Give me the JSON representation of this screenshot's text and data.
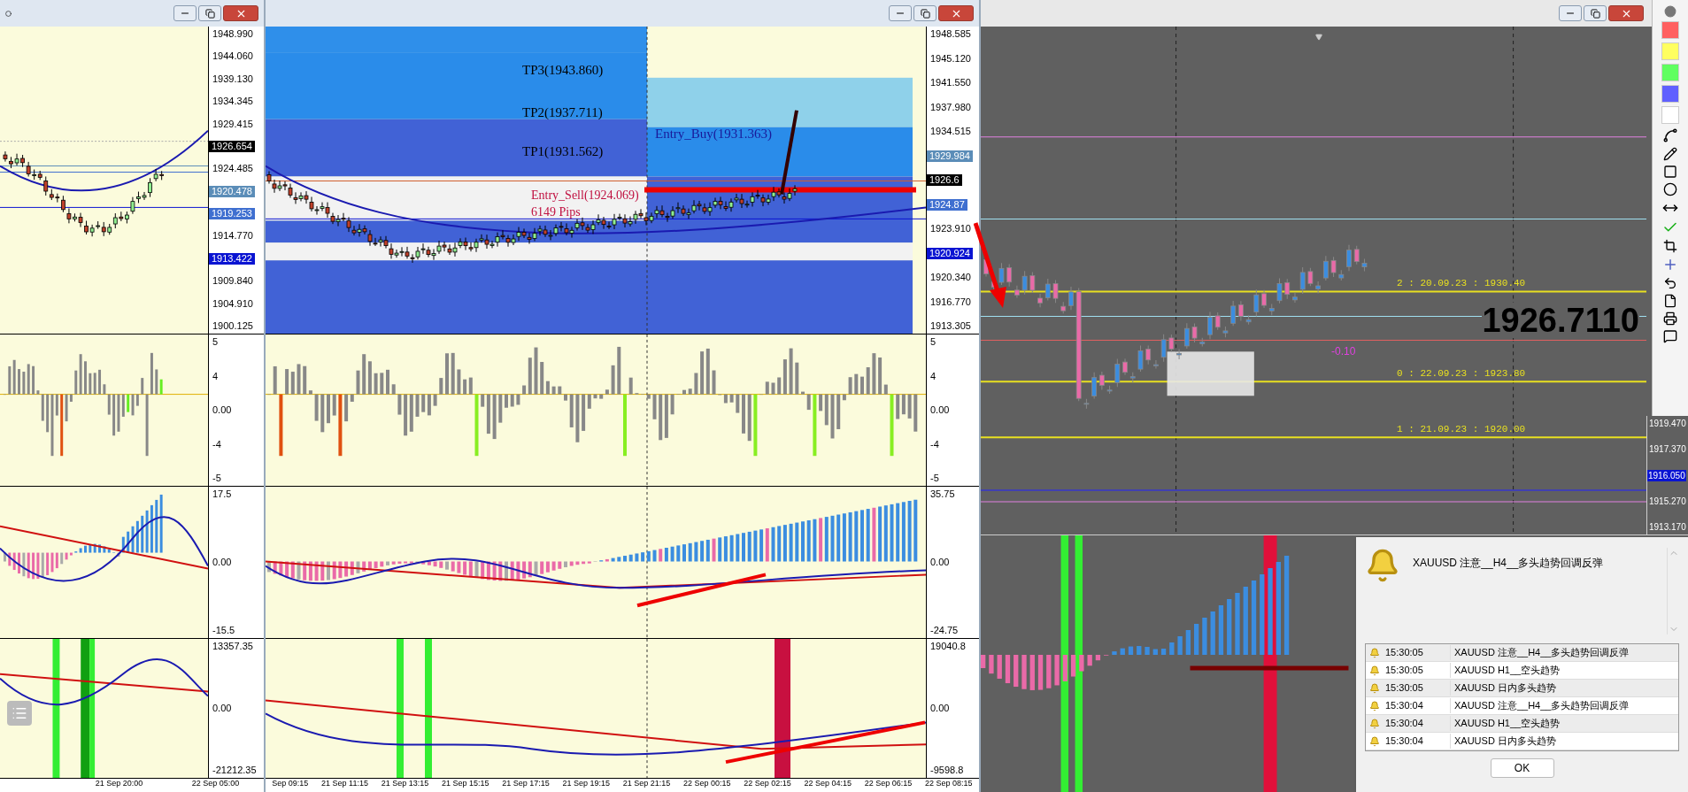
{
  "left_chart": {
    "price_axis": [
      {
        "label": "1948.990"
      },
      {
        "label": "1944.060"
      },
      {
        "label": "1939.130"
      },
      {
        "label": "1934.345"
      },
      {
        "label": "1929.415"
      },
      {
        "label": "1926.654",
        "color": "#000000"
      },
      {
        "label": "1924.485"
      },
      {
        "label": "1920.478",
        "color": "#5b8db8"
      },
      {
        "label": "1919.253",
        "color": "#3f6fd0"
      },
      {
        "label": "1914.770"
      },
      {
        "label": "1913.422",
        "color": "#0a14d2"
      },
      {
        "label": "1909.840"
      },
      {
        "label": "1904.910"
      },
      {
        "label": "1900.125"
      }
    ],
    "oscillator_axis": [
      {
        "label": "5"
      },
      {
        "label": "4"
      },
      {
        "label": "0.00"
      },
      {
        "label": "-4"
      },
      {
        "label": "-5"
      }
    ],
    "macd_axis": [
      {
        "label": "17.5"
      },
      {
        "label": "0.00"
      },
      {
        "label": "-15.5"
      }
    ],
    "volume_axis": [
      {
        "label": "13357.35"
      },
      {
        "label": "0.00"
      },
      {
        "label": "-21212.35"
      }
    ],
    "time_axis": [
      "21 Sep 20:00",
      "22 Sep 05:00"
    ]
  },
  "middle_chart": {
    "price_axis": [
      {
        "label": "1948.585"
      },
      {
        "label": "1945.120"
      },
      {
        "label": "1941.550"
      },
      {
        "label": "1937.980"
      },
      {
        "label": "1934.515"
      },
      {
        "label": "1929.984",
        "color": "#5b8db8"
      },
      {
        "label": "1926.6",
        "color": "#000000"
      },
      {
        "label": "1924.87",
        "color": "#3f6fd0"
      },
      {
        "label": "1923.910"
      },
      {
        "label": "1920.924",
        "color": "#0a14d2"
      },
      {
        "label": "1920.340"
      },
      {
        "label": "1916.770"
      },
      {
        "label": "1913.305"
      }
    ],
    "annotations": [
      {
        "kind": "target",
        "text": "TP3(1943.860)"
      },
      {
        "kind": "target",
        "text": "TP2(1937.711)"
      },
      {
        "kind": "target",
        "text": "TP1(1931.562)"
      },
      {
        "kind": "entry_buy",
        "text": "Entry_Buy(1931.363)"
      },
      {
        "kind": "entry_sell",
        "text": "Entry_Sell(1924.069)"
      },
      {
        "kind": "pips",
        "text": "6149 Pips"
      }
    ],
    "oscillator_axis": [
      {
        "label": "5"
      },
      {
        "label": "4"
      },
      {
        "label": "0.00"
      },
      {
        "label": "-4"
      },
      {
        "label": "-5"
      }
    ],
    "macd_axis": [
      {
        "label": "35.75"
      },
      {
        "label": "0.00"
      },
      {
        "label": "-24.75"
      }
    ],
    "volume_axis": [
      {
        "label": "19040.8"
      },
      {
        "label": "0.00"
      },
      {
        "label": "-9598.8"
      }
    ],
    "time_axis": [
      "Sep 09:15",
      "21 Sep 11:15",
      "21 Sep 13:15",
      "21 Sep 15:15",
      "21 Sep 17:15",
      "21 Sep 19:15",
      "21 Sep 21:15",
      "22 Sep 00:15",
      "22 Sep 02:15",
      "22 Sep 04:15",
      "22 Sep 06:15",
      "22 Sep 08:15"
    ]
  },
  "right_chart": {
    "current_price": "1926.7110",
    "change": "-0.10",
    "levels": [
      {
        "text": "2 : 20.09.23 : 1930.40"
      },
      {
        "text": "0 : 22.09.23 : 1923.80"
      },
      {
        "text": "1 : 21.09.23 : 1920.00"
      }
    ],
    "price_axis": [
      {
        "label": "1919.470"
      },
      {
        "label": "1917.370"
      },
      {
        "label": "1916.050",
        "color": "#0a14d2"
      },
      {
        "label": "1915.270"
      },
      {
        "label": "1913.170"
      }
    ]
  },
  "palette": {
    "swatches": [
      {
        "color": "#ff6060"
      },
      {
        "color": "#ffff60"
      },
      {
        "color": "#60ff60"
      },
      {
        "color": "#6060ff"
      },
      {
        "color": "#ffffff"
      }
    ]
  },
  "alert": {
    "message": "XAUUSD 注意__H4__多头趋势回调反弹",
    "log": [
      {
        "time": "15:30:05",
        "text": "XAUUSD 注意__H4__多头趋势回调反弹"
      },
      {
        "time": "15:30:05",
        "text": "XAUUSD H1__空头趋势"
      },
      {
        "time": "15:30:05",
        "text": "XAUUSD 日内多头趋势"
      },
      {
        "time": "15:30:04",
        "text": "XAUUSD 注意__H4__多头趋势回调反弹"
      },
      {
        "time": "15:30:04",
        "text": "XAUUSD H1__空头趋势"
      },
      {
        "time": "15:30:04",
        "text": "XAUUSD 日内多头趋势"
      }
    ],
    "button": "OK"
  }
}
